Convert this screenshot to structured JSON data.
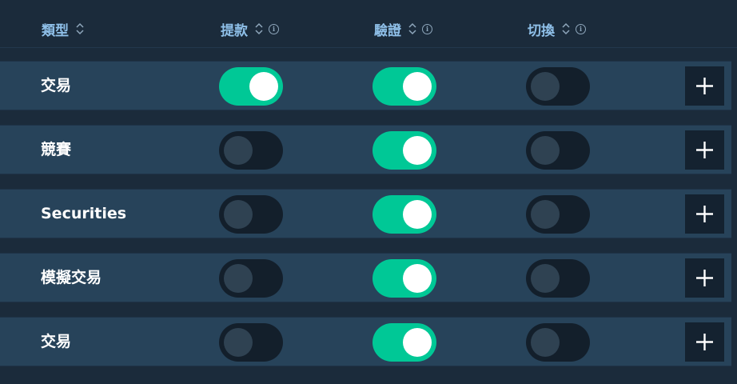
{
  "columns": {
    "type_label": "類型",
    "withdraw_label": "提款",
    "verify_label": "驗證",
    "switch_label": "切換"
  },
  "rows": [
    {
      "label": "交易",
      "withdraw": true,
      "verify": true,
      "switch": false
    },
    {
      "label": "競賽",
      "withdraw": false,
      "verify": true,
      "switch": false
    },
    {
      "label": "Securities",
      "withdraw": false,
      "verify": true,
      "switch": false
    },
    {
      "label": "模擬交易",
      "withdraw": false,
      "verify": true,
      "switch": false
    },
    {
      "label": "交易",
      "withdraw": false,
      "verify": true,
      "switch": false
    }
  ],
  "colors": {
    "accent": "#00c896",
    "header_text": "#8fc0e9",
    "row_bg": "#27435a",
    "page_bg": "#1b2b3b"
  },
  "icons": {
    "sort": "sort-icon",
    "info": "info-icon",
    "add": "plus-icon"
  }
}
